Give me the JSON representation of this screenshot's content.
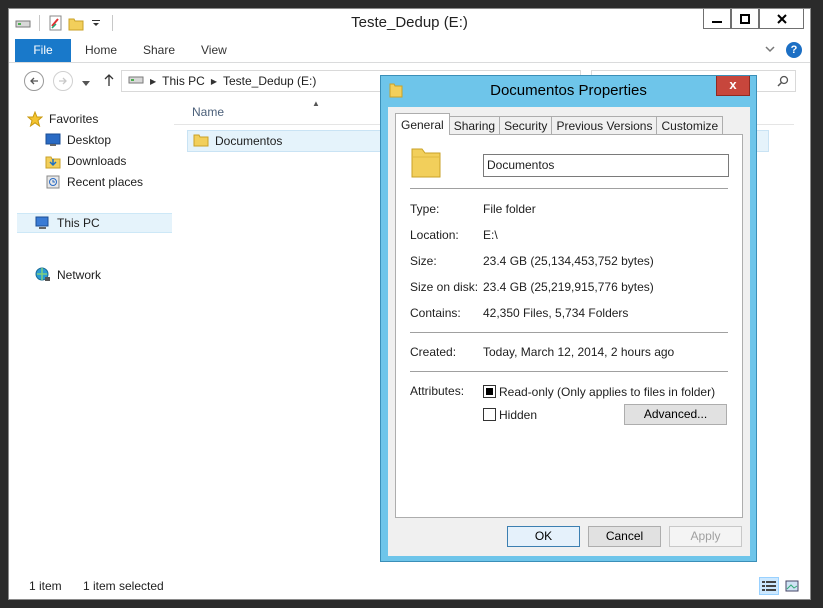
{
  "explorer": {
    "title": "Teste_Dedup (E:)",
    "ribbon": {
      "file": "File",
      "home": "Home",
      "share": "Share",
      "view": "View"
    },
    "address": {
      "this_pc": "This PC",
      "drive": "Teste_Dedup (E:)"
    },
    "nav": {
      "favorites": "Favorites",
      "desktop": "Desktop",
      "downloads": "Downloads",
      "recent": "Recent places",
      "this_pc": "This PC",
      "network": "Network"
    },
    "column_name": "Name",
    "items": [
      {
        "name": "Documentos"
      }
    ],
    "status": {
      "count": "1 item",
      "selected": "1 item selected"
    }
  },
  "dialog": {
    "title": "Documentos Properties",
    "tabs": [
      "General",
      "Sharing",
      "Security",
      "Previous Versions",
      "Customize"
    ],
    "name_value": "Documentos",
    "props": {
      "type_label": "Type:",
      "type_value": "File folder",
      "location_label": "Location:",
      "location_value": "E:\\",
      "size_label": "Size:",
      "size_value": "23.4 GB (25,134,453,752 bytes)",
      "disk_label": "Size on disk:",
      "disk_value": "23.4 GB (25,219,915,776 bytes)",
      "contains_label": "Contains:",
      "contains_value": "42,350 Files, 5,734 Folders",
      "created_label": "Created:",
      "created_value": "Today, March 12, 2014, 2 hours ago",
      "attributes_label": "Attributes:",
      "readonly_label": "Read-only (Only applies to files in folder)",
      "hidden_label": "Hidden",
      "advanced_label": "Advanced..."
    },
    "buttons": {
      "ok": "OK",
      "cancel": "Cancel",
      "apply": "Apply"
    },
    "close_glyph": "x"
  },
  "colors": {
    "accent": "#1979ca",
    "dialog_frame": "#6ec5ea",
    "close_red": "#c7463c",
    "selection": "#e5f3fb"
  }
}
